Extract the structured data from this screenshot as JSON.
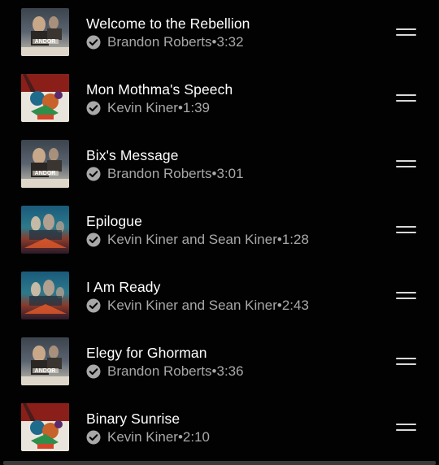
{
  "tracks": [
    {
      "title": "Welcome to the Rebellion",
      "artist": "Brandon Roberts",
      "duration": "3:32",
      "art": "andor"
    },
    {
      "title": "Mon Mothma's Speech",
      "artist": "Kevin Kiner",
      "duration": "1:39",
      "art": "rebels"
    },
    {
      "title": "Bix's Message",
      "artist": "Brandon Roberts",
      "duration": "3:01",
      "art": "andor"
    },
    {
      "title": "Epilogue",
      "artist": "Kevin Kiner and Sean Kiner",
      "duration": "1:28",
      "art": "ahsoka"
    },
    {
      "title": "I Am Ready",
      "artist": "Kevin Kiner and Sean Kiner",
      "duration": "2:43",
      "art": "ahsoka"
    },
    {
      "title": "Elegy for Ghorman",
      "artist": "Brandon Roberts",
      "duration": "3:36",
      "art": "andor"
    },
    {
      "title": "Binary Sunrise",
      "artist": "Kevin Kiner",
      "duration": "2:10",
      "art": "rebels"
    }
  ],
  "separator": " • ",
  "icons": {
    "verified": "check-circle-icon",
    "reorder": "drag-handle-icon"
  },
  "colors": {
    "background": "#020202",
    "title": "#ffffff",
    "subtitle": "#a8a8a8",
    "handle": "#d9d9d9"
  }
}
